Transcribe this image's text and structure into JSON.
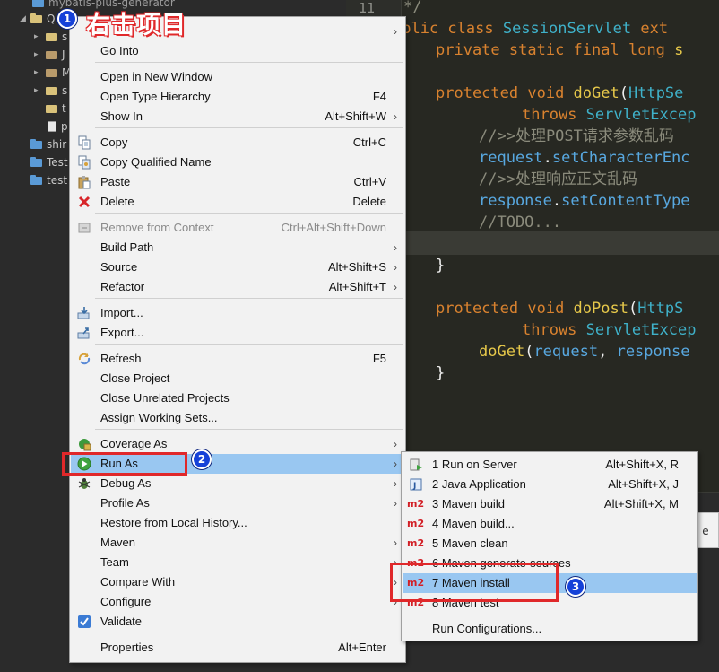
{
  "explorer": {
    "top_item": "mybatis-plus-generator",
    "project_label": "Q",
    "items": [
      "s",
      "J",
      "M",
      "s",
      "t",
      "p"
    ],
    "projects": [
      "shir",
      "Test",
      "test"
    ]
  },
  "editor": {
    "line_number": "11",
    "lines": [
      {
        "parts": [
          {
            "t": "*/",
            "c": "cmt"
          }
        ]
      },
      {
        "parts": [
          {
            "t": "ublic ",
            "c": "kw"
          },
          {
            "t": "class ",
            "c": "kw"
          },
          {
            "t": "SessionServlet ",
            "c": "cls"
          },
          {
            "t": "ext",
            "c": "kw"
          }
        ]
      },
      {
        "parts": [
          {
            "t": "private ",
            "c": "kw"
          },
          {
            "t": "static ",
            "c": "kw"
          },
          {
            "t": "final ",
            "c": "kw"
          },
          {
            "t": "long ",
            "c": "kw"
          },
          {
            "t": "s",
            "c": "fn"
          }
        ]
      },
      {
        "parts": []
      },
      {
        "parts": [
          {
            "t": "protected ",
            "c": "kw"
          },
          {
            "t": "void ",
            "c": "kw"
          },
          {
            "t": "doGet",
            "c": "fn"
          },
          {
            "t": "(",
            "c": "plain"
          },
          {
            "t": "HttpSe",
            "c": "cls"
          }
        ]
      },
      {
        "parts": [
          {
            "t": "throws ",
            "c": "kw"
          },
          {
            "t": "ServletExcep",
            "c": "cls"
          }
        ]
      },
      {
        "parts": [
          {
            "t": "//>>处理POST请求参数乱码",
            "c": "cmt"
          }
        ]
      },
      {
        "parts": [
          {
            "t": "request",
            "c": "var"
          },
          {
            "t": ".",
            "c": "plain"
          },
          {
            "t": "setCharacterEnc",
            "c": "var"
          }
        ]
      },
      {
        "parts": [
          {
            "t": "//>>处理响应正文乱码",
            "c": "cmt"
          }
        ]
      },
      {
        "parts": [
          {
            "t": "response",
            "c": "var"
          },
          {
            "t": ".",
            "c": "plain"
          },
          {
            "t": "setContentType",
            "c": "var"
          }
        ]
      },
      {
        "parts": [
          {
            "t": "//TODO...",
            "c": "cmt"
          }
        ]
      },
      {
        "parts": []
      },
      {
        "parts": [
          {
            "t": "}",
            "c": "plain"
          }
        ]
      },
      {
        "parts": []
      },
      {
        "parts": [
          {
            "t": "protected ",
            "c": "kw"
          },
          {
            "t": "void ",
            "c": "kw"
          },
          {
            "t": "doPost",
            "c": "fn"
          },
          {
            "t": "(",
            "c": "plain"
          },
          {
            "t": "HttpS",
            "c": "cls"
          }
        ]
      },
      {
        "parts": [
          {
            "t": "throws ",
            "c": "kw"
          },
          {
            "t": "ServletExcep",
            "c": "cls"
          }
        ]
      },
      {
        "parts": [
          {
            "t": "doGet",
            "c": "fn"
          },
          {
            "t": "(",
            "c": "plain"
          },
          {
            "t": "request",
            "c": "var"
          },
          {
            "t": ", ",
            "c": "plain"
          },
          {
            "t": "response",
            "c": "var"
          }
        ]
      },
      {
        "parts": [
          {
            "t": "}",
            "c": "plain"
          }
        ]
      }
    ],
    "bottom_panel_text": "e"
  },
  "context_menu": {
    "items": [
      {
        "label": "",
        "shortcut": "",
        "submenu": true
      },
      {
        "label": "Go Into",
        "shortcut": ""
      },
      {
        "label": "Open in New Window",
        "shortcut": ""
      },
      {
        "label": "Open Type Hierarchy",
        "shortcut": "F4"
      },
      {
        "label": "Show In",
        "shortcut": "Alt+Shift+W",
        "submenu": true
      },
      {
        "label": "Copy",
        "shortcut": "Ctrl+C",
        "icon": "copy-icon"
      },
      {
        "label": "Copy Qualified Name",
        "shortcut": "",
        "icon": "copy-qualified-name-icon"
      },
      {
        "label": "Paste",
        "shortcut": "Ctrl+V",
        "icon": "paste-icon"
      },
      {
        "label": "Delete",
        "shortcut": "Delete",
        "icon": "delete-icon"
      },
      {
        "label": "Remove from Context",
        "shortcut": "Ctrl+Alt+Shift+Down",
        "disabled": true,
        "icon": "remove-context-icon"
      },
      {
        "label": "Build Path",
        "shortcut": "",
        "submenu": true
      },
      {
        "label": "Source",
        "shortcut": "Alt+Shift+S",
        "submenu": true
      },
      {
        "label": "Refactor",
        "shortcut": "Alt+Shift+T",
        "submenu": true
      },
      {
        "label": "Import...",
        "shortcut": "",
        "icon": "import-icon"
      },
      {
        "label": "Export...",
        "shortcut": "",
        "icon": "export-icon"
      },
      {
        "label": "Refresh",
        "shortcut": "F5",
        "icon": "refresh-icon"
      },
      {
        "label": "Close Project",
        "shortcut": ""
      },
      {
        "label": "Close Unrelated Projects",
        "shortcut": ""
      },
      {
        "label": "Assign Working Sets...",
        "shortcut": ""
      },
      {
        "label": "Coverage As",
        "shortcut": "",
        "submenu": true,
        "icon": "coverage-icon"
      },
      {
        "label": "Run As",
        "shortcut": "",
        "submenu": true,
        "icon": "run-icon",
        "highlighted": true
      },
      {
        "label": "Debug As",
        "shortcut": "",
        "submenu": true,
        "icon": "debug-icon"
      },
      {
        "label": "Profile As",
        "shortcut": "",
        "submenu": true
      },
      {
        "label": "Restore from Local History...",
        "shortcut": ""
      },
      {
        "label": "Maven",
        "shortcut": "",
        "submenu": true
      },
      {
        "label": "Team",
        "shortcut": "",
        "submenu": true
      },
      {
        "label": "Compare With",
        "shortcut": "",
        "submenu": true
      },
      {
        "label": "Configure",
        "shortcut": "",
        "submenu": true
      },
      {
        "label": "Validate",
        "shortcut": "",
        "icon": "validate-check-icon"
      },
      {
        "label": "Properties",
        "shortcut": "Alt+Enter"
      }
    ]
  },
  "run_as_submenu": {
    "items": [
      {
        "label": "1 Run on Server",
        "shortcut": "Alt+Shift+X, R",
        "icon": "server-icon"
      },
      {
        "label": "2 Java Application",
        "shortcut": "Alt+Shift+X, J",
        "icon": "java-app-icon"
      },
      {
        "label": "3 Maven build",
        "shortcut": "Alt+Shift+X, M",
        "icon": "maven-m2-icon"
      },
      {
        "label": "4 Maven build...",
        "shortcut": "",
        "icon": "maven-m2-icon"
      },
      {
        "label": "5 Maven clean",
        "shortcut": "",
        "icon": "maven-m2-icon"
      },
      {
        "label": "6 Maven generate-sources",
        "shortcut": "",
        "icon": "maven-m2-icon"
      },
      {
        "label": "7 Maven install",
        "shortcut": "",
        "icon": "maven-m2-icon",
        "highlighted": true
      },
      {
        "label": "8 Maven test",
        "shortcut": "",
        "icon": "maven-m2-icon"
      },
      {
        "label": "Run Configurations...",
        "shortcut": ""
      }
    ],
    "m2_text": "m2"
  },
  "annotations": {
    "title": "右击项目",
    "step1": "1",
    "step2": "2",
    "step3": "3"
  },
  "colors": {
    "highlight": "#99c7f1",
    "annotation_red": "#e0282a",
    "badge_blue": "#1541d8"
  }
}
